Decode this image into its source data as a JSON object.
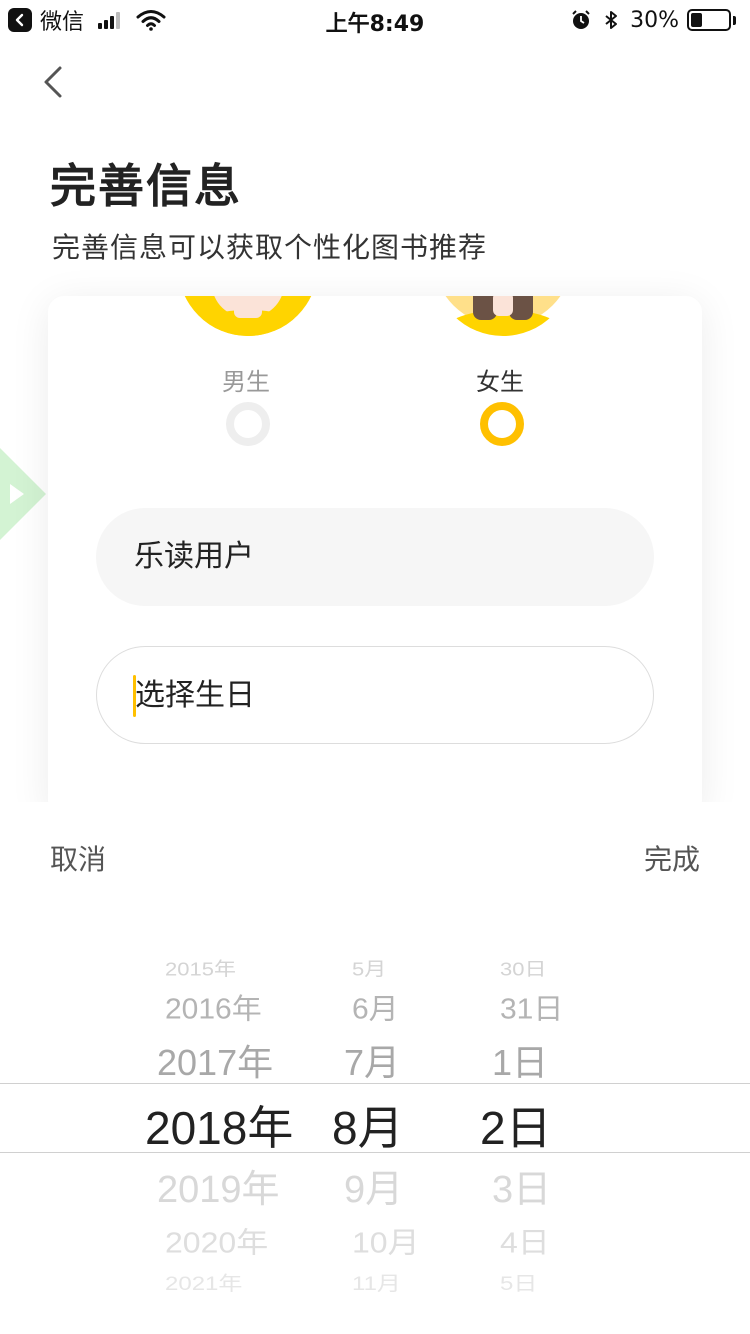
{
  "status_bar": {
    "back_app": "微信",
    "time": "上午8:49",
    "battery_percent": "30%",
    "battery_level": 0.3,
    "icons": [
      "signal-icon",
      "wifi-icon",
      "alarm-icon",
      "bluetooth-icon",
      "battery-icon"
    ]
  },
  "header": {
    "title": "完善信息",
    "subtitle": "完善信息可以获取个性化图书推荐"
  },
  "gender": {
    "male_label": "男生",
    "female_label": "女生",
    "selected": "female"
  },
  "form": {
    "nickname_value": "乐读用户",
    "birthday_placeholder": "选择生日"
  },
  "picker": {
    "cancel_label": "取消",
    "done_label": "完成",
    "years": [
      "2015年",
      "2016年",
      "2017年",
      "2018年",
      "2019年",
      "2020年",
      "2021年"
    ],
    "months": [
      "5月",
      "6月",
      "7月",
      "8月",
      "9月",
      "10月",
      "11月"
    ],
    "days": [
      "30日",
      "31日",
      "1日",
      "2日",
      "3日",
      "4日",
      "5日"
    ],
    "selected": {
      "year": "2018年",
      "month": "8月",
      "day": "2日"
    }
  },
  "colors": {
    "accent": "#ffc000",
    "field_bg": "#f6f6f6",
    "side_arrow": "#c8f0c8"
  }
}
